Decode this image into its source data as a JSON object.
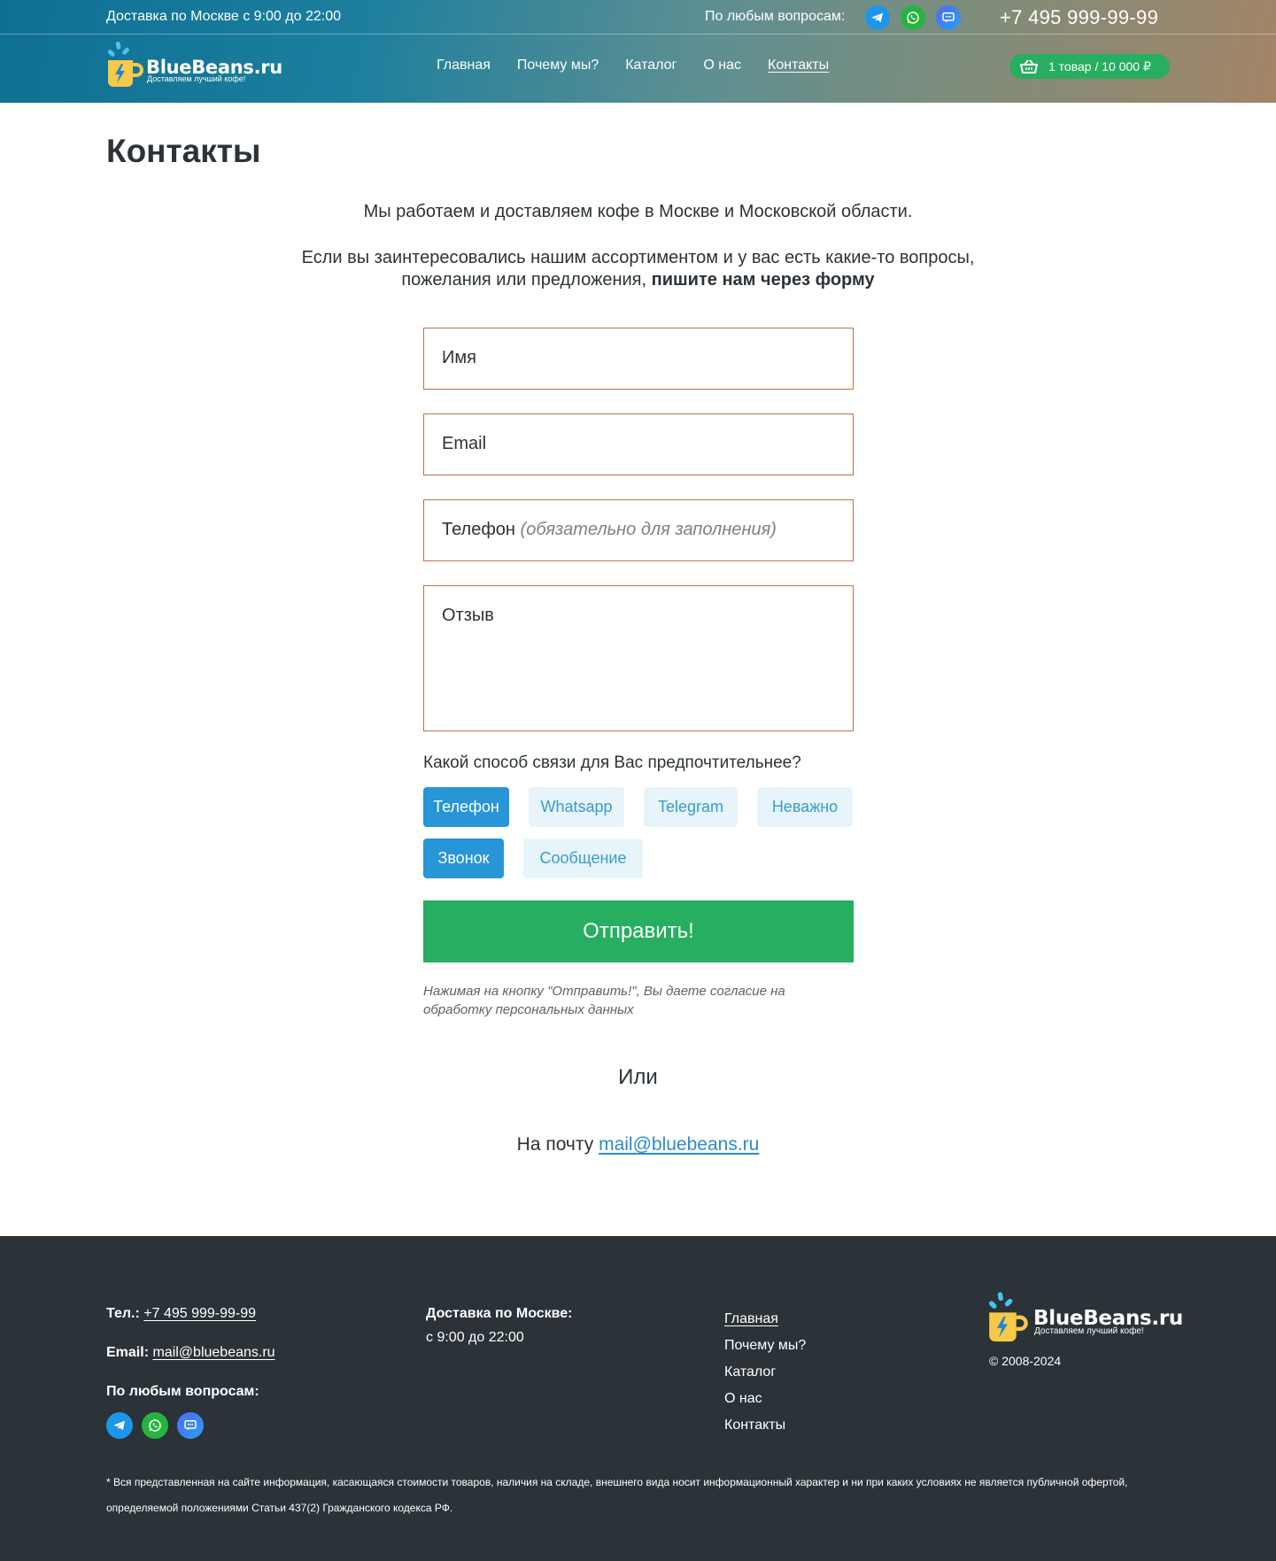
{
  "header": {
    "delivery": "Доставка по Москве с 9:00 до 22:00",
    "questions_label": "По любым вопросам:",
    "messengers": [
      "telegram-icon",
      "whatsapp-icon",
      "chat-icon"
    ],
    "phone": "+7 495 999-99-99",
    "logo_name": "BlueBeans.ru",
    "logo_tagline": "Доставляем лучший кофе!",
    "nav": [
      "Главная",
      "Почему мы?",
      "Каталог",
      "О нас",
      "Контакты"
    ],
    "nav_active": "Контакты",
    "cart": "1 товар / 10 000 ₽"
  },
  "main": {
    "title": "Контакты",
    "intro1": "Мы работаем и доставляем кофе в Москве и Московской области.",
    "intro2": "Если вы заинтересовались нашим ассортиментом и у вас есть какие-то вопросы, пожелания или предложения,",
    "intro2_bold": "пишите нам через форму",
    "form": {
      "name_placeholder": "Имя",
      "email_placeholder": "Email",
      "phone_placeholder": "Телефон",
      "phone_hint": "(обязательно для заполнения)",
      "review_placeholder": "Отзыв",
      "pref_question": "Какой способ связи для Вас предпочтительнее?",
      "channel_options": [
        "Телефон",
        "Whatsapp",
        "Telegram",
        "Неважно"
      ],
      "channel_selected": "Телефон",
      "type_options": [
        "Звонок",
        "Сообщение"
      ],
      "type_selected": "Звонок",
      "submit_label": "Отправить!",
      "consent": "Нажимая на кнопку \"Отправить!\", Вы даете согласие на обработку персональных данных"
    },
    "or_label": "Или",
    "mail_prefix": "На почту",
    "mail": "mail@bluebeans.ru"
  },
  "footer": {
    "tel_label": "Тел.:",
    "tel": "+7 495 999-99-99",
    "email_label": "Email:",
    "email": "mail@bluebeans.ru",
    "questions_label": "По любым вопросам:",
    "delivery_label": "Доставка по Москве:",
    "delivery_hours": "с 9:00 до 22:00",
    "nav": [
      "Главная",
      "Почему мы?",
      "Каталог",
      "О нас",
      "Контакты"
    ],
    "copyright": "© 2008-2024",
    "disclaimer": "* Вся представленная на сайте информация, касающаяся стоимости товаров, наличия на складе, внешнего вида носит информационный характер и ни при каких условиях не является публичной офертой, определяемой положениями Статьи 437(2) Гражданского кодекса РФ."
  },
  "colors": {
    "accent_green": "#27ae60",
    "accent_blue": "#2795d6",
    "field_border": "#b8734a",
    "footer_bg": "#2b3338"
  }
}
